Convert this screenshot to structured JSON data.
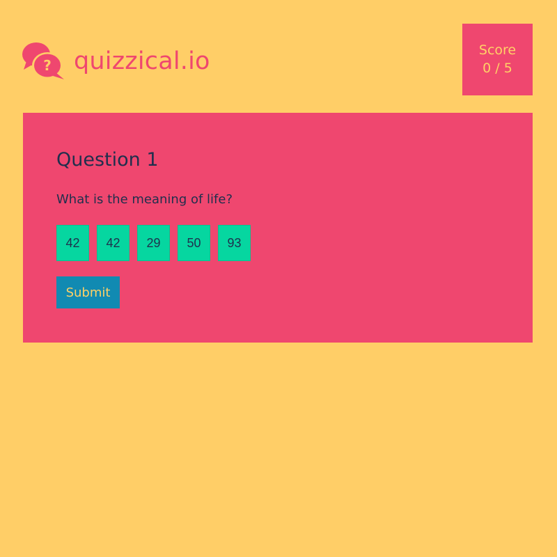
{
  "brand": {
    "name": "quizzical.io",
    "logo_icon": "speech-bubbles-question-icon",
    "logo_mark": "?"
  },
  "score": {
    "label": "Score",
    "value": "0 / 5"
  },
  "question": {
    "title": "Question 1",
    "text": "What is the meaning of life?",
    "answers": [
      "42",
      "42",
      "29",
      "50",
      "93"
    ]
  },
  "actions": {
    "submit_label": "Submit"
  },
  "colors": {
    "background": "#FFCE67",
    "accent": "#EF476F",
    "answer_bg": "#06D6A0",
    "submit_bg": "#118AB2",
    "text_dark": "#1F2F4D",
    "text_light": "#FFD166"
  }
}
